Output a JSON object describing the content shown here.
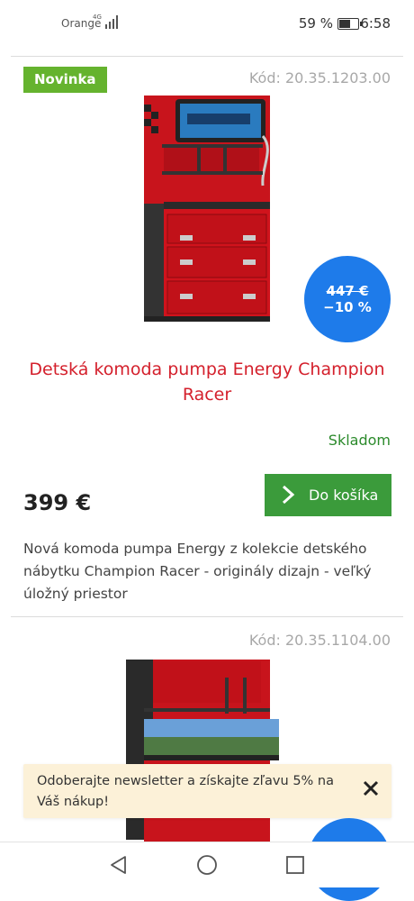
{
  "status_bar": {
    "carrier": "Orange",
    "network": "4G",
    "battery": "59 %",
    "battery_level": 0.59,
    "time": "6:58"
  },
  "product1": {
    "badge": "Novinka",
    "code": "Kód: 20.35.1203.00",
    "old_price": "447 €",
    "discount": "−10 %",
    "title": "Detská komoda pumpa Energy Champion Racer",
    "stock": "Skladom",
    "price": "399 €",
    "cart_button": "Do košíka",
    "description": "Nová komoda pumpa Energy z kolekcie detského nábytku Champion Racer - originály dizajn - veľký úložný priestor"
  },
  "product2": {
    "code": "Kód: 20.35.1104.00"
  },
  "newsletter": {
    "text": "Odoberajte newsletter a získajte zľavu 5% na Váš nákup!"
  },
  "colors": {
    "accent_green": "#65b32e",
    "button_green": "#3b9b3b",
    "title_red": "#d4202c",
    "discount_blue": "#1e7bea",
    "banner_bg": "#fcf1d8"
  },
  "icons": {
    "back": "triangle-back-icon",
    "home": "circle-home-icon",
    "recents": "square-recents-icon",
    "close": "close-icon"
  }
}
